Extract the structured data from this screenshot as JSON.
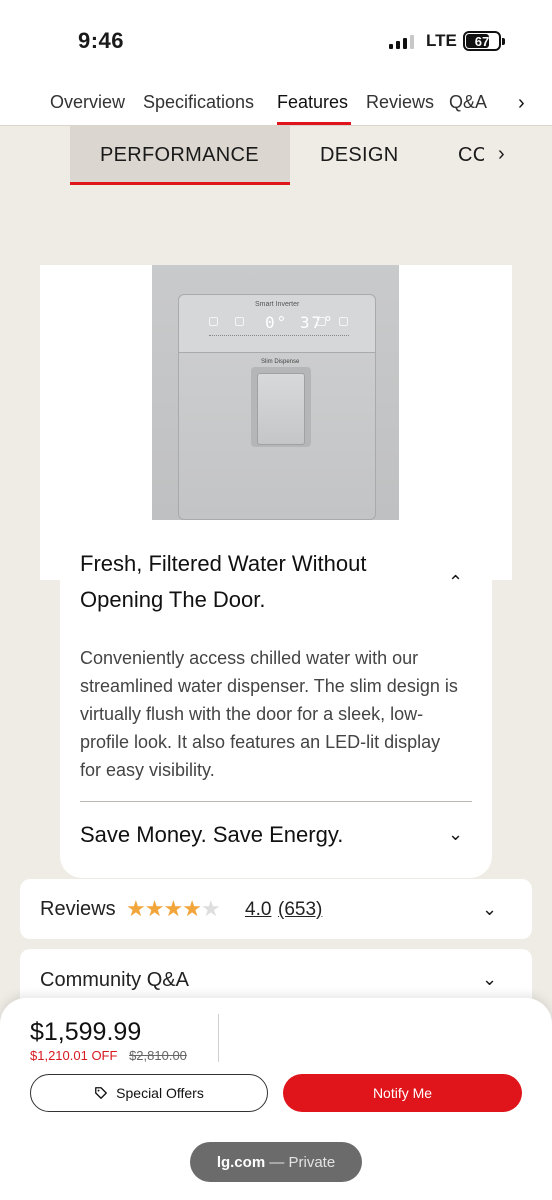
{
  "status_bar": {
    "time": "9:46",
    "network": "LTE",
    "battery": "67"
  },
  "nav": {
    "tabs": [
      "Overview",
      "Specifications",
      "Features",
      "Reviews",
      "Q&A"
    ],
    "active": "Features"
  },
  "sub_tabs": {
    "items": [
      "PERFORMANCE",
      "DESIGN",
      "CC"
    ],
    "active": "PERFORMANCE"
  },
  "product_image": {
    "display_brand": "Smart Inverter",
    "display_temp": "0° 37°",
    "badge": "Slim Dispense"
  },
  "features": {
    "item1": {
      "title": "Fresh, Filtered Water Without Opening The Door.",
      "description": "Conveniently access chilled water with our streamlined water dispenser. The slim design is virtually flush with the door for a sleek, low-profile look. It also features an LED-lit display for easy visibility.",
      "expanded": true
    },
    "item2": {
      "title": "Save Money. Save Energy.",
      "expanded": false
    }
  },
  "reviews": {
    "label": "Reviews",
    "rating": "4.0",
    "count": "(653)",
    "stars_filled": 4,
    "stars_total": 5
  },
  "qa": {
    "label": "Community Q&A"
  },
  "purchase": {
    "price": "$1,599.99",
    "off": "$1,210.01 OFF",
    "original_price": "$2,810.00",
    "special_offers_label": "Special Offers",
    "notify_label": "Notify Me"
  },
  "browser": {
    "domain": "lg.com",
    "mode": "— Private"
  },
  "colors": {
    "accent_red": "#e0151b",
    "star_gold": "#f2a53a",
    "page_bg": "#efebe5"
  },
  "icons": [
    "chevron-right-icon",
    "chevron-up-icon",
    "chevron-down-icon",
    "star-icon",
    "tag-icon",
    "battery-icon",
    "signal-icon"
  ]
}
